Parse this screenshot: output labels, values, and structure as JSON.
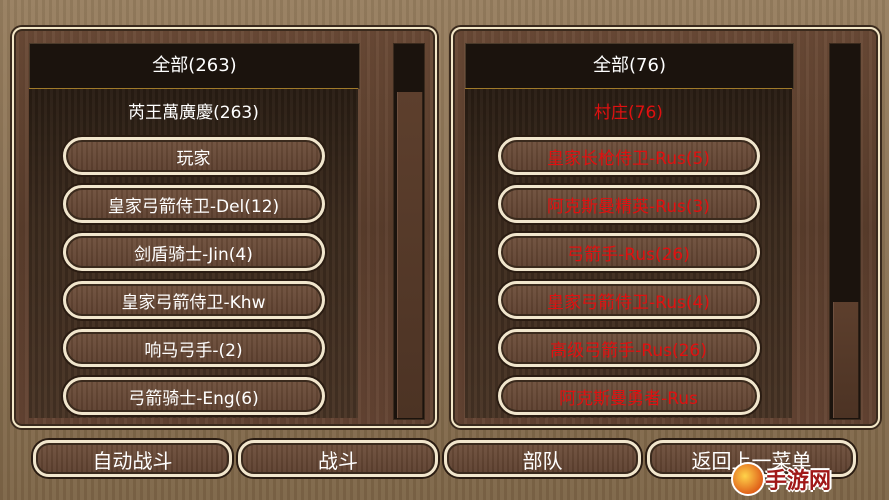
{
  "left_panel": {
    "header": "全部(263)",
    "group_title": "芮王萬廣慶(263)",
    "items": [
      "玩家",
      "皇家弓箭侍卫-Del(12)",
      "剑盾骑士-Jin(4)",
      "皇家弓箭侍卫-Khw",
      "响马弓手-(2)",
      "弓箭骑士-Eng(6)"
    ]
  },
  "right_panel": {
    "header": "全部(76)",
    "group_title": "村庄(76)",
    "items": [
      "皇家长枪侍卫-Rus(5)",
      "阿克斯曼精英-Rus(3)",
      "弓箭手-Rus(26)",
      "皇家弓箭侍卫-Rus(4)",
      "高级弓箭手-Rus(26)",
      "阿克斯曼勇者-Rus"
    ]
  },
  "buttons": {
    "auto_battle": "自动战斗",
    "battle": "战斗",
    "troops": "部队",
    "back": "返回上一菜单"
  },
  "watermark": {
    "text": "手游网"
  },
  "colors": {
    "enemy_text": "#e01010",
    "ally_text": "#ffffff",
    "border": "#f1e6cd"
  }
}
